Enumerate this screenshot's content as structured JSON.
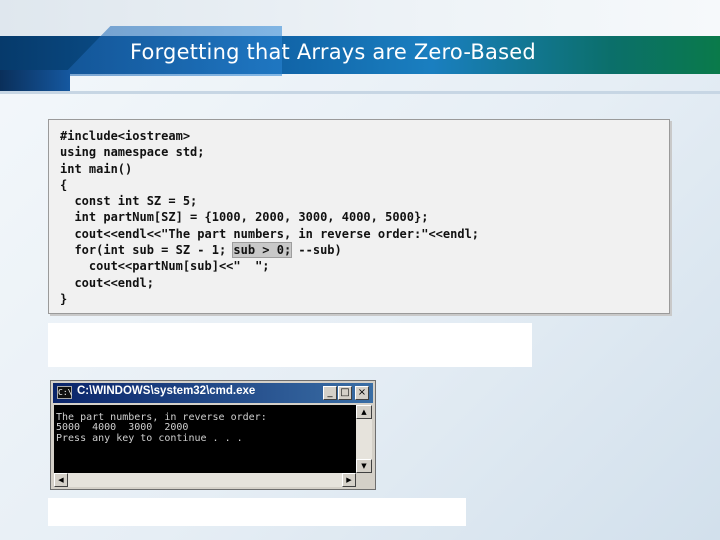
{
  "slide": {
    "title": "Forgetting that Arrays are Zero-Based"
  },
  "code": {
    "lines": [
      "#include<iostream>",
      "using namespace std;",
      "int main()",
      "{",
      "  const int SZ = 5;",
      "  int partNum[SZ] = {1000, 2000, 3000, 4000, 5000};",
      "  cout<<endl<<\"The part numbers, in reverse order:\"<<endl;",
      "  for(int sub = SZ - 1; ",
      "    cout<<partNum[sub]<<\"  \";",
      "  cout<<endl;",
      "}"
    ],
    "highlight": "sub > 0;",
    "line8_tail": " --sub)"
  },
  "console": {
    "title": "C:\\WINDOWS\\system32\\cmd.exe",
    "icon": "cmd-icon",
    "buttons": {
      "minimize": "_",
      "maximize": "□",
      "close": "×"
    },
    "output": [
      "The part numbers, in reverse order:",
      "5000  4000  3000  2000",
      "Press any key to continue . . ."
    ]
  },
  "colors": {
    "header_band": "#0f5fa3",
    "titlebar": "#0a246a",
    "code_bg": "#f1f1f1",
    "console_bg": "#000000"
  }
}
